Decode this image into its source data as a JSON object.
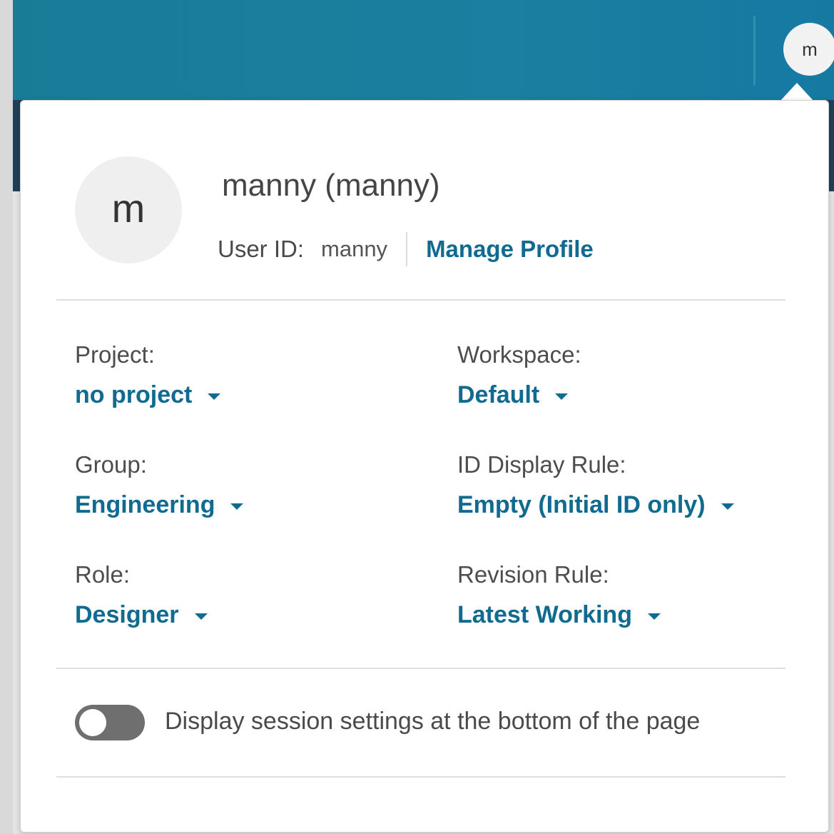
{
  "header": {
    "avatar_initial": "m"
  },
  "profile": {
    "avatar_initial": "m",
    "display_name": "manny (manny)",
    "user_id_label": "User ID:",
    "user_id_value": "manny",
    "manage_profile_link": "Manage Profile"
  },
  "session": {
    "project": {
      "label": "Project:",
      "value": "no project"
    },
    "workspace": {
      "label": "Workspace:",
      "value": "Default"
    },
    "group": {
      "label": "Group:",
      "value": "Engineering"
    },
    "id_display_rule": {
      "label": "ID Display Rule:",
      "value": "Empty (Initial ID only)"
    },
    "role": {
      "label": "Role:",
      "value": "Designer"
    },
    "revision_rule": {
      "label": "Revision Rule:",
      "value": "Latest Working"
    }
  },
  "settings": {
    "display_bottom_toggle_label": "Display session settings at the bottom of the page",
    "display_bottom_toggle_on": false
  },
  "colors": {
    "header_bg": "#1a7fa0",
    "link": "#116b90",
    "toggle_off": "#6f6f6f"
  },
  "icons": [
    "caret-down-icon"
  ]
}
